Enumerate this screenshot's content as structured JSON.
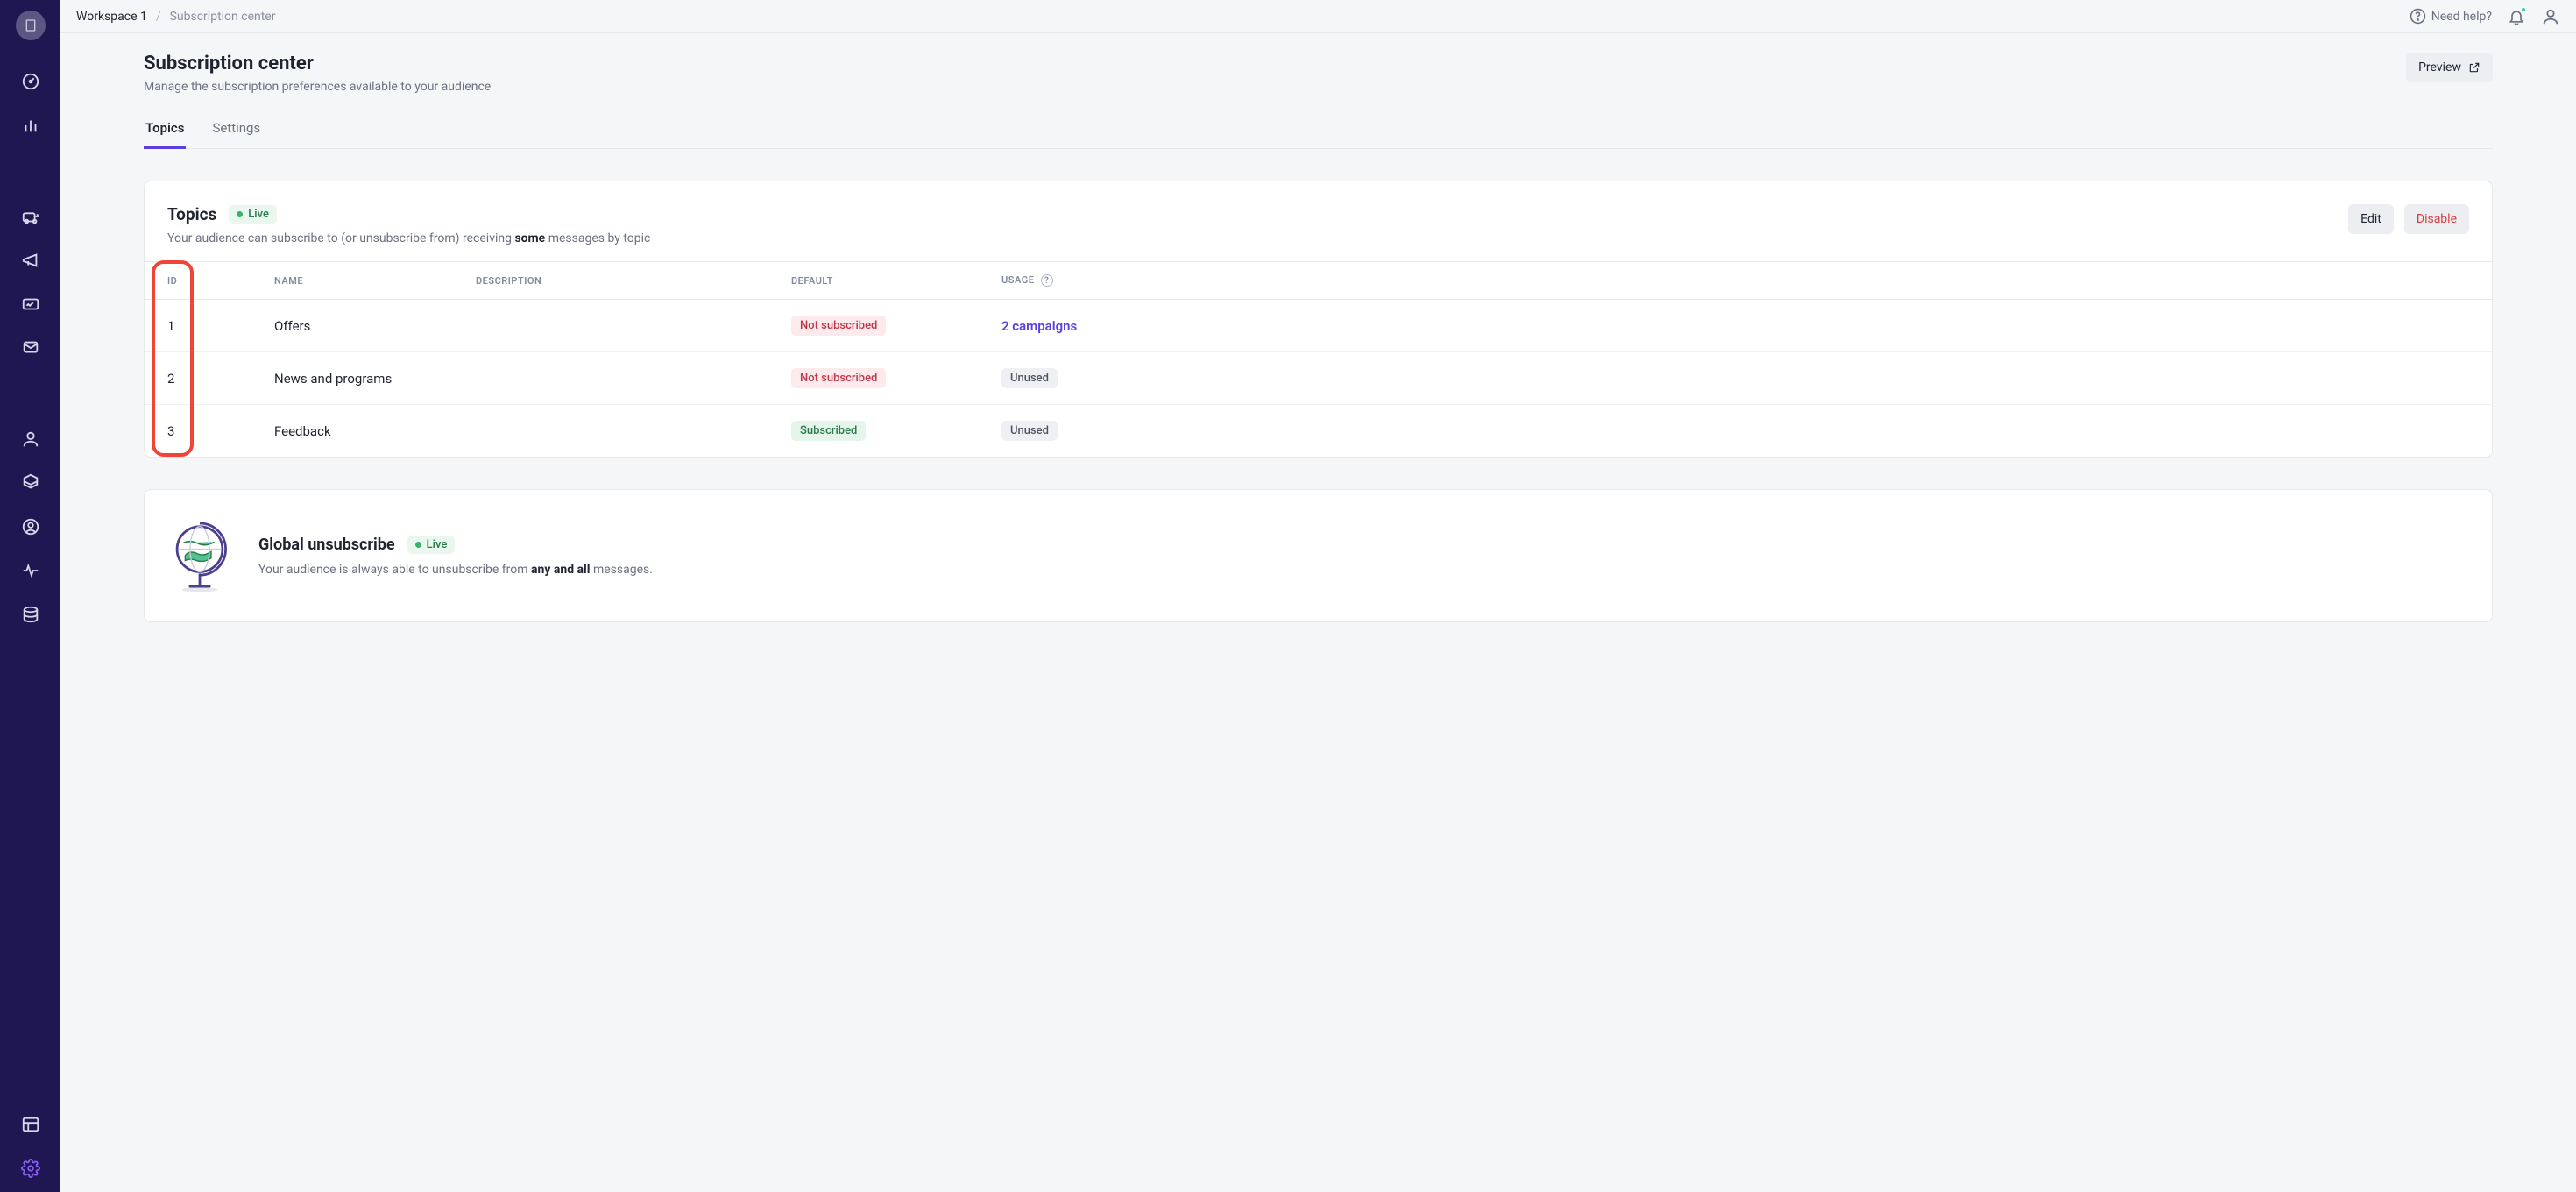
{
  "breadcrumb": {
    "workspace": "Workspace 1",
    "page": "Subscription center"
  },
  "topbar": {
    "help": "Need help?"
  },
  "page": {
    "title": "Subscription center",
    "subtitle": "Manage the subscription preferences available to your audience",
    "preview_btn": "Preview"
  },
  "tabs": {
    "topics": "Topics",
    "settings": "Settings"
  },
  "topics_card": {
    "title": "Topics",
    "live": "Live",
    "sub_prefix": "Your audience can subscribe to (or unsubscribe from) receiving ",
    "sub_bold": "some",
    "sub_suffix": " messages by topic",
    "edit_btn": "Edit",
    "disable_btn": "Disable",
    "columns": {
      "id": "ID",
      "name": "NAME",
      "description": "DESCRIPTION",
      "default": "DEFAULT",
      "usage": "USAGE"
    },
    "rows": [
      {
        "id": "1",
        "name": "Offers",
        "description": "",
        "default": "Not subscribed",
        "default_kind": "red",
        "usage": "2 campaigns",
        "usage_kind": "link"
      },
      {
        "id": "2",
        "name": "News and programs",
        "description": "",
        "default": "Not subscribed",
        "default_kind": "red",
        "usage": "Unused",
        "usage_kind": "grey"
      },
      {
        "id": "3",
        "name": "Feedback",
        "description": "",
        "default": "Subscribed",
        "default_kind": "green",
        "usage": "Unused",
        "usage_kind": "grey"
      }
    ]
  },
  "global_card": {
    "title": "Global unsubscribe",
    "live": "Live",
    "sub_prefix": "Your audience is always able to unsubscribe from ",
    "sub_bold": "any and all",
    "sub_suffix": " messages."
  }
}
